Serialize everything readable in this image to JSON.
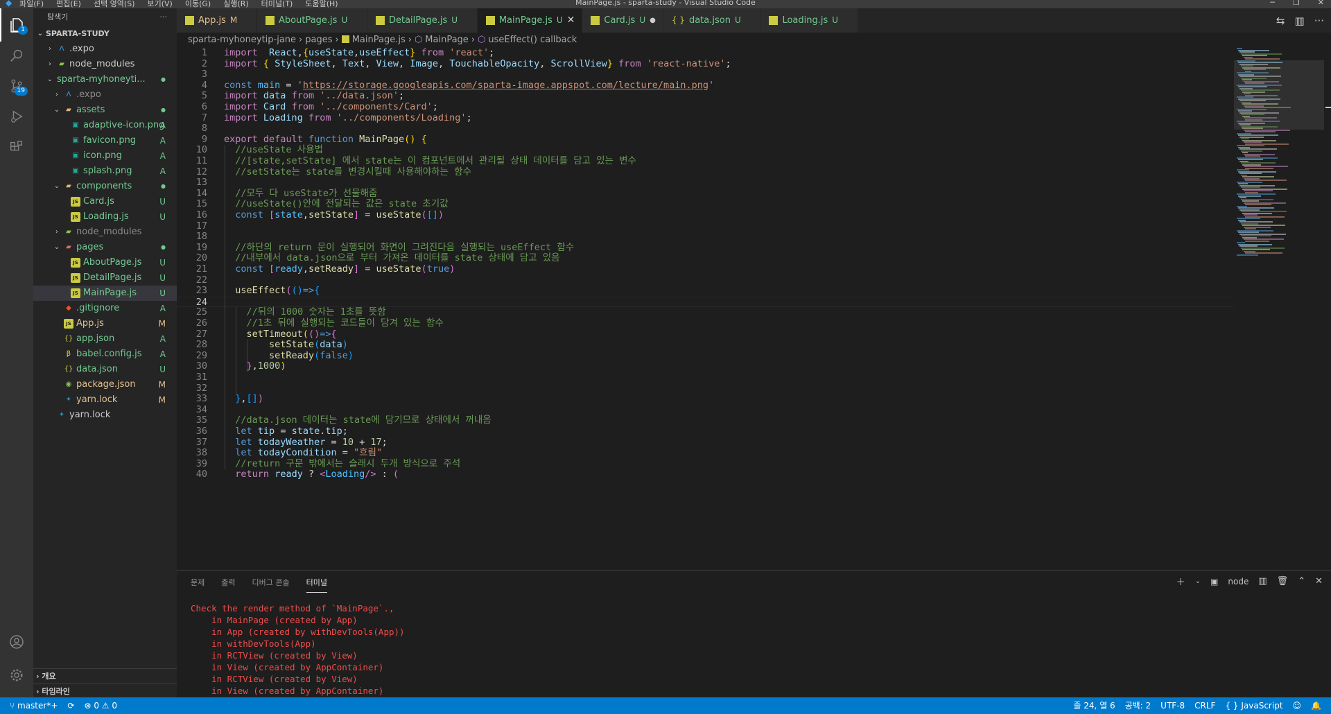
{
  "window": {
    "title": "MainPage.js - sparta-study - Visual Studio Code",
    "menu": [
      "파일(F)",
      "편집(E)",
      "선택 영역(S)",
      "보기(V)",
      "이동(G)",
      "실행(R)",
      "터미널(T)",
      "도움말(H)"
    ]
  },
  "activity": {
    "icons": [
      "files-icon",
      "search-icon",
      "source-control-icon",
      "run-debug-icon",
      "extensions-icon",
      "account-icon",
      "gear-icon"
    ],
    "explorer_badge": "1",
    "scm_badge": "19"
  },
  "sidebar": {
    "header": "탐색기",
    "more": "···",
    "root": "SPARTA-STUDY",
    "items": [
      {
        "label": ".expo",
        "indent": 1,
        "kind": "folder",
        "icon": "expo",
        "open": false,
        "status": ""
      },
      {
        "label": "node_modules",
        "indent": 1,
        "kind": "folder",
        "icon": "node",
        "open": false,
        "status": ""
      },
      {
        "label": "sparta-myhoneyti...",
        "indent": 1,
        "kind": "folder",
        "icon": "none",
        "open": true,
        "status": "●",
        "cls": "c-green"
      },
      {
        "label": ".expo",
        "indent": 2,
        "kind": "folder",
        "icon": "expo",
        "open": false,
        "status": "",
        "cls": "c-grey"
      },
      {
        "label": "assets",
        "indent": 2,
        "kind": "folder",
        "icon": "folder",
        "open": true,
        "status": "●",
        "cls": "c-green"
      },
      {
        "label": "adaptive-icon.png",
        "indent": 3,
        "kind": "file",
        "icon": "img",
        "status": "A",
        "cls": "c-green"
      },
      {
        "label": "favicon.png",
        "indent": 3,
        "kind": "file",
        "icon": "img",
        "status": "A",
        "cls": "c-green"
      },
      {
        "label": "icon.png",
        "indent": 3,
        "kind": "file",
        "icon": "img",
        "status": "A",
        "cls": "c-green"
      },
      {
        "label": "splash.png",
        "indent": 3,
        "kind": "file",
        "icon": "img",
        "status": "A",
        "cls": "c-green"
      },
      {
        "label": "components",
        "indent": 2,
        "kind": "folder",
        "icon": "folder",
        "open": true,
        "status": "●",
        "cls": "c-green"
      },
      {
        "label": "Card.js",
        "indent": 3,
        "kind": "file",
        "icon": "js",
        "status": "U",
        "cls": "c-green"
      },
      {
        "label": "Loading.js",
        "indent": 3,
        "kind": "file",
        "icon": "js",
        "status": "U",
        "cls": "c-green"
      },
      {
        "label": "node_modules",
        "indent": 2,
        "kind": "folder",
        "icon": "node",
        "open": false,
        "status": "",
        "cls": "c-grey"
      },
      {
        "label": "pages",
        "indent": 2,
        "kind": "folder",
        "icon": "folder-red",
        "open": true,
        "status": "●",
        "cls": "c-green"
      },
      {
        "label": "AboutPage.js",
        "indent": 3,
        "kind": "file",
        "icon": "js",
        "status": "U",
        "cls": "c-green"
      },
      {
        "label": "DetailPage.js",
        "indent": 3,
        "kind": "file",
        "icon": "js",
        "status": "U",
        "cls": "c-green"
      },
      {
        "label": "MainPage.js",
        "indent": 3,
        "kind": "file",
        "icon": "js",
        "status": "U",
        "cls": "c-green",
        "selected": true
      },
      {
        "label": ".gitignore",
        "indent": 2,
        "kind": "file",
        "icon": "git",
        "status": "A",
        "cls": "c-green"
      },
      {
        "label": "App.js",
        "indent": 2,
        "kind": "file",
        "icon": "js",
        "status": "M",
        "cls": "c-yellow"
      },
      {
        "label": "app.json",
        "indent": 2,
        "kind": "file",
        "icon": "json",
        "status": "A",
        "cls": "c-green"
      },
      {
        "label": "babel.config.js",
        "indent": 2,
        "kind": "file",
        "icon": "babel",
        "status": "A",
        "cls": "c-green"
      },
      {
        "label": "data.json",
        "indent": 2,
        "kind": "file",
        "icon": "json",
        "status": "U",
        "cls": "c-green"
      },
      {
        "label": "package.json",
        "indent": 2,
        "kind": "file",
        "icon": "npm",
        "status": "M",
        "cls": "c-yellow"
      },
      {
        "label": "yarn.lock",
        "indent": 2,
        "kind": "file",
        "icon": "yarn",
        "status": "M",
        "cls": "c-yellow"
      },
      {
        "label": "yarn.lock",
        "indent": 1,
        "kind": "file",
        "icon": "yarn",
        "status": ""
      }
    ],
    "outline": "개요",
    "timeline": "타임라인"
  },
  "tabs": [
    {
      "label": "App.js",
      "icon": "js",
      "status": "M",
      "active": false
    },
    {
      "label": "AboutPage.js",
      "icon": "js",
      "status": "U",
      "active": false
    },
    {
      "label": "DetailPage.js",
      "icon": "js",
      "status": "U",
      "active": false
    },
    {
      "label": "MainPage.js",
      "icon": "js",
      "status": "U",
      "active": true
    },
    {
      "label": "Card.js",
      "icon": "js",
      "status": "U",
      "active": false,
      "dirty": true
    },
    {
      "label": "data.json",
      "icon": "json",
      "status": "U",
      "active": false
    },
    {
      "label": "Loading.js",
      "icon": "js",
      "status": "U",
      "active": false
    }
  ],
  "breadcrumb": [
    "sparta-myhoneytip-jane",
    "pages",
    "MainPage.js",
    "MainPage",
    "useEffect() callback"
  ],
  "editor": {
    "current_line": 24,
    "lines": [
      [
        [
          "kw2",
          "import"
        ],
        [
          "",
          "  "
        ],
        [
          "vr",
          "React"
        ],
        [
          "",
          ","
        ],
        [
          "br1",
          "{"
        ],
        [
          "vr",
          "useState"
        ],
        [
          "",
          ","
        ],
        [
          "vr",
          "useEffect"
        ],
        [
          "br1",
          "}"
        ],
        [
          "",
          " "
        ],
        [
          "kw2",
          "from"
        ],
        [
          "",
          " "
        ],
        [
          "str",
          "'react'"
        ],
        [
          "",
          ";"
        ]
      ],
      [
        [
          "kw2",
          "import"
        ],
        [
          "",
          " "
        ],
        [
          "br1",
          "{"
        ],
        [
          "",
          " "
        ],
        [
          "vr",
          "StyleSheet"
        ],
        [
          "",
          ", "
        ],
        [
          "vr",
          "Text"
        ],
        [
          "",
          ", "
        ],
        [
          "vr",
          "View"
        ],
        [
          "",
          ", "
        ],
        [
          "vr",
          "Image"
        ],
        [
          "",
          ", "
        ],
        [
          "vr",
          "TouchableOpacity"
        ],
        [
          "",
          ", "
        ],
        [
          "vr",
          "ScrollView"
        ],
        [
          "br1",
          "}"
        ],
        [
          "",
          " "
        ],
        [
          "kw2",
          "from"
        ],
        [
          "",
          " "
        ],
        [
          "str",
          "'react-native'"
        ],
        [
          "",
          ";"
        ]
      ],
      [],
      [
        [
          "kw",
          "const"
        ],
        [
          "",
          " "
        ],
        [
          "cn",
          "main"
        ],
        [
          "",
          " = "
        ],
        [
          "str",
          "'"
        ],
        [
          "url",
          "https://storage.googleapis.com/sparta-image.appspot.com/lecture/main.png"
        ],
        [
          "str",
          "'"
        ]
      ],
      [
        [
          "kw2",
          "import"
        ],
        [
          "",
          " "
        ],
        [
          "vr",
          "data"
        ],
        [
          "",
          " "
        ],
        [
          "kw2",
          "from"
        ],
        [
          "",
          " "
        ],
        [
          "str",
          "'../data.json'"
        ],
        [
          "",
          ";"
        ]
      ],
      [
        [
          "kw2",
          "import"
        ],
        [
          "",
          " "
        ],
        [
          "vr",
          "Card"
        ],
        [
          "",
          " "
        ],
        [
          "kw2",
          "from"
        ],
        [
          "",
          " "
        ],
        [
          "str",
          "'../components/Card'"
        ],
        [
          "",
          ";"
        ]
      ],
      [
        [
          "kw2",
          "import"
        ],
        [
          "",
          " "
        ],
        [
          "vr",
          "Loading"
        ],
        [
          "",
          " "
        ],
        [
          "kw2",
          "from"
        ],
        [
          "",
          " "
        ],
        [
          "str",
          "'../components/Loading'"
        ],
        [
          "",
          ";"
        ]
      ],
      [],
      [
        [
          "kw2",
          "export"
        ],
        [
          "",
          " "
        ],
        [
          "kw2",
          "default"
        ],
        [
          "",
          " "
        ],
        [
          "kw",
          "function"
        ],
        [
          "",
          " "
        ],
        [
          "fn",
          "MainPage"
        ],
        [
          "br1",
          "()"
        ],
        [
          "",
          " "
        ],
        [
          "br1",
          "{"
        ]
      ],
      [
        [
          "",
          "  "
        ],
        [
          "cm",
          "//useState 사용법"
        ]
      ],
      [
        [
          "",
          "  "
        ],
        [
          "cm",
          "//[state,setState] 에서 state는 이 컴포넌트에서 관리될 상태 데이터를 담고 있는 변수"
        ]
      ],
      [
        [
          "",
          "  "
        ],
        [
          "cm",
          "//setState는 state를 변경시킬때 사용해야하는 함수"
        ]
      ],
      [],
      [
        [
          "",
          "  "
        ],
        [
          "cm",
          "//모두 다 useState가 선물해줌"
        ]
      ],
      [
        [
          "",
          "  "
        ],
        [
          "cm",
          "//useState()안에 전달되는 값은 state 초기값"
        ]
      ],
      [
        [
          "",
          "  "
        ],
        [
          "kw",
          "const"
        ],
        [
          "",
          " "
        ],
        [
          "br2",
          "["
        ],
        [
          "cn",
          "state"
        ],
        [
          "",
          ","
        ],
        [
          "fn",
          "setState"
        ],
        [
          "br2",
          "]"
        ],
        [
          "",
          " = "
        ],
        [
          "fn",
          "useState"
        ],
        [
          "br2",
          "("
        ],
        [
          "br3",
          "[]"
        ],
        [
          "br2",
          ")"
        ]
      ],
      [],
      [],
      [
        [
          "",
          "  "
        ],
        [
          "cm",
          "//하단의 return 문이 실행되어 화면이 그려진다음 실행되는 useEffect 함수"
        ]
      ],
      [
        [
          "",
          "  "
        ],
        [
          "cm",
          "//내부에서 data.json으로 부터 가져온 데이터를 state 상태에 담고 있음"
        ]
      ],
      [
        [
          "",
          "  "
        ],
        [
          "kw",
          "const"
        ],
        [
          "",
          " "
        ],
        [
          "br2",
          "["
        ],
        [
          "cn",
          "ready"
        ],
        [
          "",
          ","
        ],
        [
          "fn",
          "setReady"
        ],
        [
          "br2",
          "]"
        ],
        [
          "",
          " = "
        ],
        [
          "fn",
          "useState"
        ],
        [
          "br2",
          "("
        ],
        [
          "kw",
          "true"
        ],
        [
          "br2",
          ")"
        ]
      ],
      [],
      [
        [
          "",
          "  "
        ],
        [
          "fn",
          "useEffect"
        ],
        [
          "br2",
          "("
        ],
        [
          "br3",
          "()"
        ],
        [
          "kw",
          "=>"
        ],
        [
          "br3",
          "{"
        ]
      ],
      [],
      [
        [
          "",
          "    "
        ],
        [
          "cm",
          "//뒤의 1000 숫자는 1초를 뜻함"
        ]
      ],
      [
        [
          "",
          "    "
        ],
        [
          "cm",
          "//1초 뒤에 실행되는 코드들이 담겨 있는 함수"
        ]
      ],
      [
        [
          "",
          "    "
        ],
        [
          "fn",
          "setTimeout"
        ],
        [
          "br1",
          "("
        ],
        [
          "br2",
          "()"
        ],
        [
          "kw",
          "=>"
        ],
        [
          "br2",
          "{"
        ]
      ],
      [
        [
          "",
          "        "
        ],
        [
          "fn",
          "setState"
        ],
        [
          "br3",
          "("
        ],
        [
          "vr",
          "data"
        ],
        [
          "br3",
          ")"
        ]
      ],
      [
        [
          "",
          "        "
        ],
        [
          "fn",
          "setReady"
        ],
        [
          "br3",
          "("
        ],
        [
          "kw",
          "false"
        ],
        [
          "br3",
          ")"
        ]
      ],
      [
        [
          "",
          "    "
        ],
        [
          "br2",
          "}"
        ],
        [
          "",
          ","
        ],
        [
          "num",
          "1000"
        ],
        [
          "br1",
          ")"
        ]
      ],
      [],
      [],
      [
        [
          "",
          "  "
        ],
        [
          "br3",
          "}"
        ],
        [
          "",
          ","
        ],
        [
          "br3",
          "[]"
        ],
        [
          "br2",
          ")"
        ]
      ],
      [],
      [
        [
          "",
          "  "
        ],
        [
          "cm",
          "//data.json 데이터는 state에 담기므로 상태에서 꺼내옴"
        ]
      ],
      [
        [
          "",
          "  "
        ],
        [
          "kw",
          "let"
        ],
        [
          "",
          " "
        ],
        [
          "vr",
          "tip"
        ],
        [
          "",
          " = "
        ],
        [
          "vr",
          "state"
        ],
        [
          "",
          "."
        ],
        [
          "vr",
          "tip"
        ],
        [
          "",
          ";"
        ]
      ],
      [
        [
          "",
          "  "
        ],
        [
          "kw",
          "let"
        ],
        [
          "",
          " "
        ],
        [
          "vr",
          "todayWeather"
        ],
        [
          "",
          " = "
        ],
        [
          "num",
          "10"
        ],
        [
          "",
          " + "
        ],
        [
          "num",
          "17"
        ],
        [
          "",
          ";"
        ]
      ],
      [
        [
          "",
          "  "
        ],
        [
          "kw",
          "let"
        ],
        [
          "",
          " "
        ],
        [
          "vr",
          "todayCondition"
        ],
        [
          "",
          " = "
        ],
        [
          "str",
          "\"흐림\""
        ]
      ],
      [
        [
          "",
          "  "
        ],
        [
          "cm",
          "//return 구문 밖에서는 슬래시 두개 방식으로 주석"
        ]
      ],
      [
        [
          "",
          "  "
        ],
        [
          "kw2",
          "return"
        ],
        [
          "",
          " "
        ],
        [
          "vr",
          "ready"
        ],
        [
          "",
          " ? "
        ],
        [
          "br2",
          "<"
        ],
        [
          "cn",
          "Loading"
        ],
        [
          "br2",
          "/>"
        ],
        [
          "",
          " : "
        ],
        [
          "br2",
          "("
        ]
      ]
    ]
  },
  "panel": {
    "tabs": [
      "문제",
      "출력",
      "디버그 콘솔",
      "터미널"
    ],
    "active_tab": "터미널",
    "shell": "node",
    "terminal_lines": [
      "Check the render method of `MainPage`.,",
      "    in MainPage (created by App)",
      "    in App (created by withDevTools(App))",
      "    in withDevTools(App)",
      "    in RCTView (created by View)",
      "    in View (created by AppContainer)",
      "    in RCTView (created by View)",
      "    in View (created by AppContainer)"
    ]
  },
  "statusbar": {
    "branch": "master*+",
    "sync": "⟳",
    "errors": "⊗ 0",
    "warnings": "⚠ 0",
    "position": "줄 24, 열 6",
    "spaces": "공백: 2",
    "encoding": "UTF-8",
    "eol": "CRLF",
    "language": "{ } JavaScript"
  },
  "colors": {
    "accent": "#007acc",
    "untracked": "#73c991",
    "modified": "#e2c08d",
    "error": "#f14c4c"
  }
}
